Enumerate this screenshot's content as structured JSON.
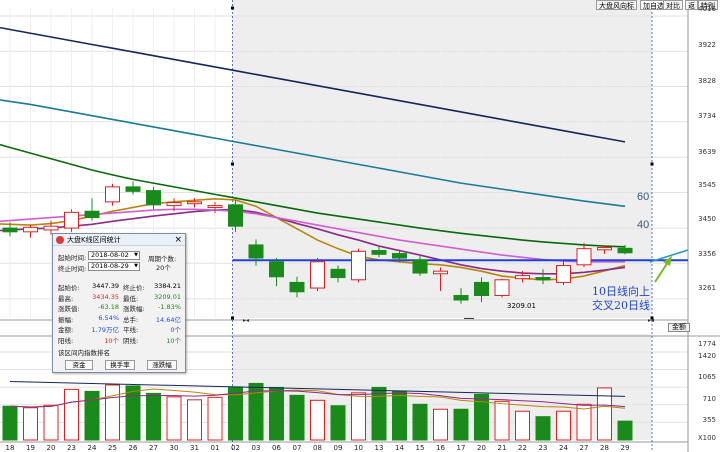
{
  "toolbar": {
    "buttons": [
      {
        "label": "大盘风向标"
      },
      {
        "label": "加自选"
      },
      {
        "label": "对比"
      },
      {
        "label": "返"
      },
      {
        "label": "特别"
      }
    ]
  },
  "chart_data": [
    {
      "type": "candlestick",
      "y_ticks": [
        "4016",
        "3922",
        "3828",
        "3734",
        "3639",
        "3545",
        "3450",
        "3356",
        "3261"
      ],
      "ylim": [
        3210,
        4016
      ],
      "x_ticks": [
        "18",
        "19",
        "20",
        "23",
        "24",
        "25",
        "26",
        "27",
        "30",
        "31",
        "01",
        "02",
        "03",
        "06",
        "07",
        "08",
        "09",
        "10",
        "13",
        "14",
        "15",
        "16",
        "17",
        "20",
        "21",
        "22",
        "23",
        "24",
        "27",
        "28",
        "29"
      ],
      "ohlc": [
        [
          3450,
          3465,
          3428,
          3440
        ],
        [
          3440,
          3458,
          3425,
          3452
        ],
        [
          3445,
          3470,
          3432,
          3455
        ],
        [
          3450,
          3500,
          3440,
          3492
        ],
        [
          3495,
          3530,
          3470,
          3478
        ],
        [
          3520,
          3568,
          3510,
          3560
        ],
        [
          3560,
          3575,
          3540,
          3548
        ],
        [
          3550,
          3560,
          3500,
          3512
        ],
        [
          3510,
          3530,
          3495,
          3518
        ],
        [
          3515,
          3530,
          3505,
          3520
        ],
        [
          3505,
          3520,
          3490,
          3510
        ],
        [
          3512,
          3525,
          3440,
          3455
        ],
        [
          3405,
          3420,
          3350,
          3370
        ],
        [
          3360,
          3370,
          3295,
          3320
        ],
        [
          3305,
          3320,
          3265,
          3280
        ],
        [
          3290,
          3370,
          3282,
          3360
        ],
        [
          3340,
          3350,
          3305,
          3318
        ],
        [
          3312,
          3395,
          3305,
          3388
        ],
        [
          3390,
          3402,
          3372,
          3380
        ],
        [
          3382,
          3392,
          3358,
          3370
        ],
        [
          3365,
          3375,
          3322,
          3330
        ],
        [
          3328,
          3345,
          3282,
          3335
        ],
        [
          3270,
          3290,
          3248,
          3258
        ],
        [
          3305,
          3318,
          3252,
          3270
        ],
        [
          3270,
          3315,
          3265,
          3312
        ],
        [
          3315,
          3335,
          3305,
          3323
        ],
        [
          3318,
          3340,
          3300,
          3312
        ],
        [
          3305,
          3360,
          3298,
          3350
        ],
        [
          3352,
          3410,
          3346,
          3395
        ],
        [
          3392,
          3402,
          3381,
          3398
        ],
        [
          3396,
          3405,
          3380,
          3384
        ]
      ],
      "colors": {
        "up": "#e02020",
        "down": "#1a8a1a"
      },
      "moving_averages": [
        {
          "name": "MA10",
          "color": "#b8860b",
          "values": [
            3460,
            3458,
            3462,
            3470,
            3482,
            3495,
            3505,
            3515,
            3520,
            3524,
            3528,
            3525,
            3508,
            3478,
            3448,
            3418,
            3395,
            3375,
            3365,
            3360,
            3355,
            3352,
            3345,
            3335,
            3322,
            3316,
            3312,
            3314,
            3322,
            3336,
            3350
          ]
        },
        {
          "name": "MA20",
          "color": "#8b2a8b",
          "values": [
            3445,
            3448,
            3450,
            3455,
            3460,
            3468,
            3475,
            3482,
            3488,
            3494,
            3498,
            3500,
            3492,
            3478,
            3462,
            3448,
            3432,
            3418,
            3402,
            3390,
            3378,
            3365,
            3352,
            3342,
            3335,
            3330,
            3328,
            3328,
            3332,
            3338,
            3345
          ]
        },
        {
          "name": "MA30",
          "color": "#d060d0",
          "values": [
            3470,
            3474,
            3478,
            3482,
            3486,
            3490,
            3494,
            3498,
            3500,
            3500,
            3498,
            3495,
            3488,
            3478,
            3468,
            3458,
            3448,
            3438,
            3428,
            3418,
            3410,
            3402,
            3394,
            3386,
            3378,
            3372,
            3366,
            3362,
            3360,
            3360,
            3360
          ]
        },
        {
          "name": "MA40",
          "color": "#0a6a0a",
          "values": [
            3665,
            3650,
            3635,
            3620,
            3605,
            3592,
            3580,
            3570,
            3560,
            3550,
            3540,
            3530,
            3520,
            3510,
            3500,
            3490,
            3482,
            3474,
            3466,
            3458,
            3450,
            3443,
            3436,
            3430,
            3424,
            3418,
            3413,
            3409,
            3405,
            3402,
            3400
          ]
        },
        {
          "name": "MA60",
          "color": "#1a7a9a",
          "values": [
            3788,
            3780,
            3770,
            3760,
            3750,
            3740,
            3730,
            3720,
            3710,
            3700,
            3690,
            3680,
            3670,
            3660,
            3650,
            3640,
            3630,
            3620,
            3610,
            3600,
            3590,
            3580,
            3570,
            3562,
            3554,
            3546,
            3538,
            3530,
            3522,
            3515,
            3508
          ]
        },
        {
          "name": "MA120",
          "color": "#14285a",
          "values": [
            3980,
            3970,
            3960,
            3950,
            3940,
            3930,
            3920,
            3910,
            3900,
            3890,
            3880,
            3870,
            3860,
            3850,
            3840,
            3830,
            3820,
            3810,
            3800,
            3790,
            3780,
            3770,
            3760,
            3750,
            3740,
            3730,
            3720,
            3710,
            3700,
            3690,
            3680
          ]
        }
      ],
      "support_line": 3364,
      "low_marker": "3209.01",
      "ma_labels": [
        "60",
        "40"
      ]
    },
    {
      "type": "bar",
      "y_ticks": [
        "1774",
        "1420",
        "1065",
        "710",
        "355"
      ],
      "unit_tag": "X100",
      "ylim": [
        0,
        1774
      ],
      "volume": [
        680,
        650,
        700,
        1020,
        980,
        1110,
        1090,
        940,
        870,
        810,
        860,
        1070,
        1140,
        1060,
        900,
        800,
        690,
        950,
        1060,
        980,
        720,
        620,
        620,
        920,
        780,
        580,
        470,
        580,
        720,
        1050,
        380
      ],
      "colors": {
        "up": "#e02020",
        "down": "#1a8a1a"
      }
    }
  ],
  "annotation": {
    "line1": "10日线向上",
    "line2": "交叉20日线"
  },
  "scroll": {
    "tag": "金额"
  },
  "dialog": {
    "title": "大盘K线区间统计",
    "close": "×",
    "start_label": "起始时间:",
    "start_value": "2018-08-02",
    "end_label": "终止时间:",
    "end_value": "2018-08-29",
    "period_label": "周期个数:",
    "period_value": "20个",
    "rows": [
      {
        "l1": "起始价:",
        "v1": "3447.39",
        "c1": "",
        "l2": "终止价:",
        "v2": "3384.21",
        "c2": ""
      },
      {
        "l1": "最高:",
        "v1": "3434.35",
        "c1": "red",
        "l2": "最低:",
        "v2": "3209.01",
        "c2": "green"
      },
      {
        "l1": "涨跌值:",
        "v1": "-63.18",
        "c1": "green",
        "l2": "涨跌幅:",
        "v2": "-1.83%",
        "c2": "green"
      },
      {
        "l1": "振幅:",
        "v1": "6.54%",
        "c1": "blue",
        "l2": "总手:",
        "v2": "14.64亿",
        "c2": "blue"
      },
      {
        "l1": "金额:",
        "v1": "1.79万亿",
        "c1": "blue",
        "l2": "平线:",
        "v2": "0个",
        "c2": "blue"
      },
      {
        "l1": "阳线:",
        "v1": "10个",
        "c1": "red",
        "l2": "阴线:",
        "v2": "10个",
        "c2": "green"
      }
    ],
    "section_title": "该区间内指数排名",
    "buttons": [
      "资金",
      "换手率",
      "涨跌幅"
    ]
  }
}
